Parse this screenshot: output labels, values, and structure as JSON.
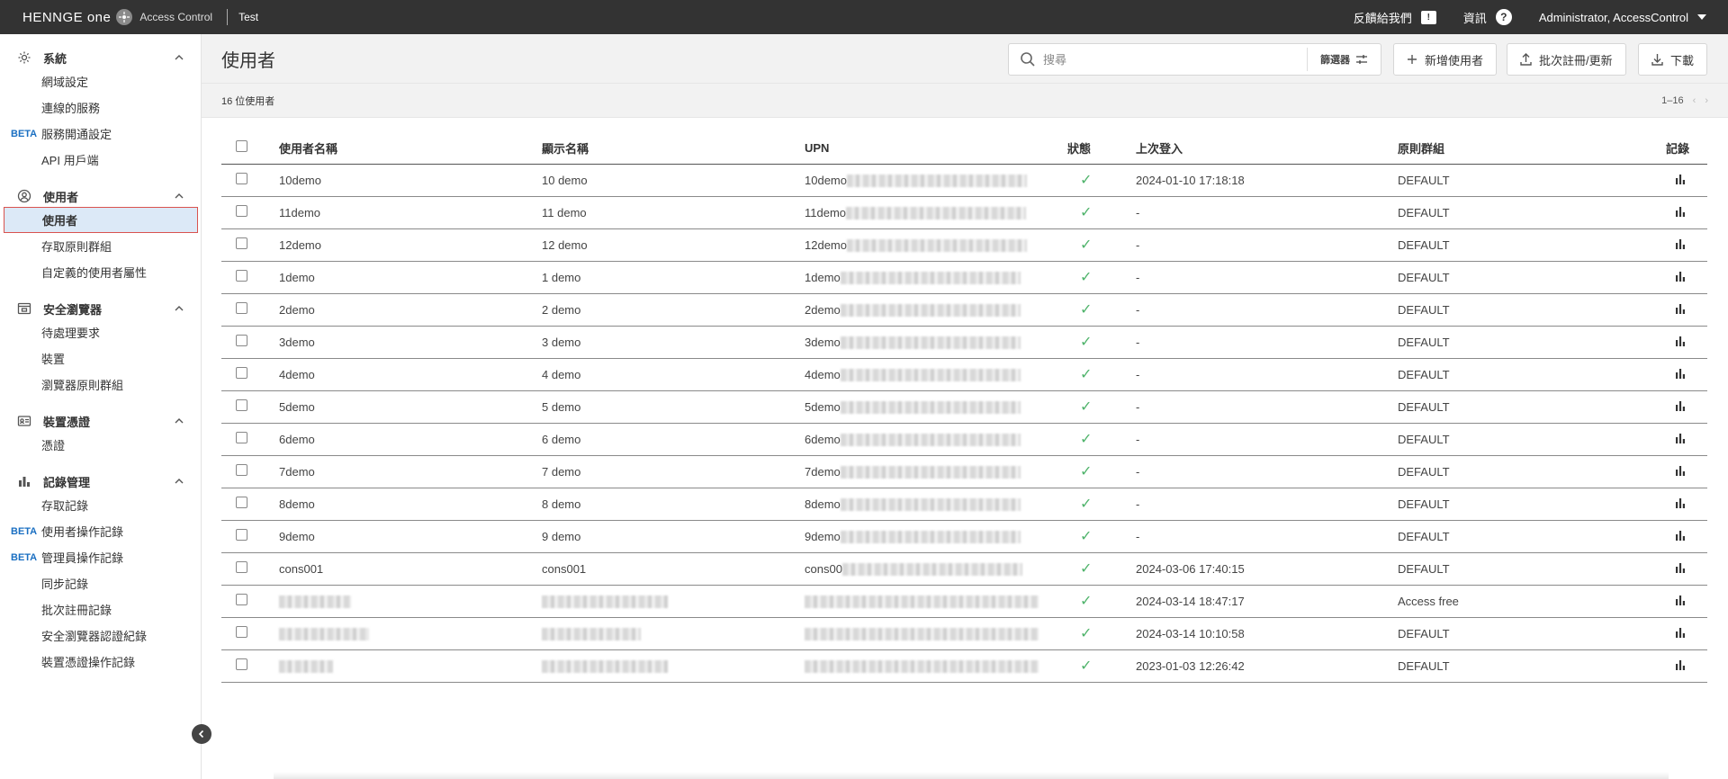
{
  "topbar": {
    "logo": "HENNGE one",
    "product": "Access Control",
    "tenant": "Test",
    "feedback": "反饋給我們",
    "info": "資訊",
    "user": "Administrator, AccessControl"
  },
  "sidebar": {
    "sections": [
      {
        "title": "系統",
        "icon": "gear-icon",
        "items": [
          {
            "label": "網域設定"
          },
          {
            "label": "連線的服務"
          },
          {
            "label": "服務開通設定",
            "beta": "BETA"
          },
          {
            "label": "API 用戶端"
          }
        ]
      },
      {
        "title": "使用者",
        "icon": "user-circle-icon",
        "items": [
          {
            "label": "使用者",
            "active": true
          },
          {
            "label": "存取原則群組"
          },
          {
            "label": "自定義的使用者屬性"
          }
        ]
      },
      {
        "title": "安全瀏覽器",
        "icon": "browser-icon",
        "items": [
          {
            "label": "待處理要求"
          },
          {
            "label": "裝置"
          },
          {
            "label": "瀏覽器原則群組"
          }
        ]
      },
      {
        "title": "裝置憑證",
        "icon": "certificate-icon",
        "items": [
          {
            "label": "憑證"
          }
        ]
      },
      {
        "title": "記錄管理",
        "icon": "bar-chart-icon",
        "items": [
          {
            "label": "存取記錄"
          },
          {
            "label": "使用者操作記錄",
            "beta": "BETA"
          },
          {
            "label": "管理員操作記錄",
            "beta": "BETA"
          },
          {
            "label": "同步記錄"
          },
          {
            "label": "批次註冊記錄"
          },
          {
            "label": "安全瀏覽器認證紀錄"
          },
          {
            "label": "裝置憑證操作記錄"
          }
        ]
      }
    ]
  },
  "header": {
    "title": "使用者",
    "search_placeholder": "搜尋",
    "filter": "篩選器",
    "add_user": "新增使用者",
    "bulk": "批次註冊/更新",
    "download": "下載"
  },
  "subbar": {
    "count": "16 位使用者",
    "range": "1–16"
  },
  "table": {
    "columns": [
      "使用者名稱",
      "顯示名稱",
      "UPN",
      "狀態",
      "上次登入",
      "原則群組",
      "記錄"
    ],
    "rows": [
      {
        "user": "10demo",
        "display": "10 demo",
        "upn": "10demo",
        "last": "2024-01-10 17:18:18",
        "policy": "DEFAULT"
      },
      {
        "user": "11demo",
        "display": "11 demo",
        "upn": "11demo",
        "last": "-",
        "policy": "DEFAULT"
      },
      {
        "user": "12demo",
        "display": "12 demo",
        "upn": "12demo",
        "last": "-",
        "policy": "DEFAULT"
      },
      {
        "user": "1demo",
        "display": "1 demo",
        "upn": "1demo",
        "last": "-",
        "policy": "DEFAULT"
      },
      {
        "user": "2demo",
        "display": "2 demo",
        "upn": "2demo",
        "last": "-",
        "policy": "DEFAULT"
      },
      {
        "user": "3demo",
        "display": "3 demo",
        "upn": "3demo",
        "last": "-",
        "policy": "DEFAULT"
      },
      {
        "user": "4demo",
        "display": "4 demo",
        "upn": "4demo",
        "last": "-",
        "policy": "DEFAULT"
      },
      {
        "user": "5demo",
        "display": "5 demo",
        "upn": "5demo",
        "last": "-",
        "policy": "DEFAULT"
      },
      {
        "user": "6demo",
        "display": "6 demo",
        "upn": "6demo",
        "last": "-",
        "policy": "DEFAULT"
      },
      {
        "user": "7demo",
        "display": "7 demo",
        "upn": "7demo",
        "last": "-",
        "policy": "DEFAULT"
      },
      {
        "user": "8demo",
        "display": "8 demo",
        "upn": "8demo",
        "last": "-",
        "policy": "DEFAULT"
      },
      {
        "user": "9demo",
        "display": "9 demo",
        "upn": "9demo",
        "last": "-",
        "policy": "DEFAULT"
      },
      {
        "user": "cons001",
        "display": "cons001",
        "upn": "cons00",
        "last": "2024-03-06 17:40:15",
        "policy": "DEFAULT"
      },
      {
        "user": "",
        "display": "",
        "upn": "",
        "last": "2024-03-14 18:47:17",
        "policy": "Access free"
      },
      {
        "user": "",
        "display": "",
        "upn": "",
        "last": "2024-03-14 10:10:58",
        "policy": "DEFAULT"
      },
      {
        "user": "",
        "display": "",
        "upn": "",
        "last": "2023-01-03 12:26:42",
        "policy": "DEFAULT"
      }
    ]
  },
  "colors": {
    "topbar": "#333333",
    "header_bg": "#f2f2f2",
    "active_bg": "#dce9f7",
    "beta": "#1a6fc2",
    "check": "#4fb36b",
    "highlight_border": "#d9534f"
  }
}
